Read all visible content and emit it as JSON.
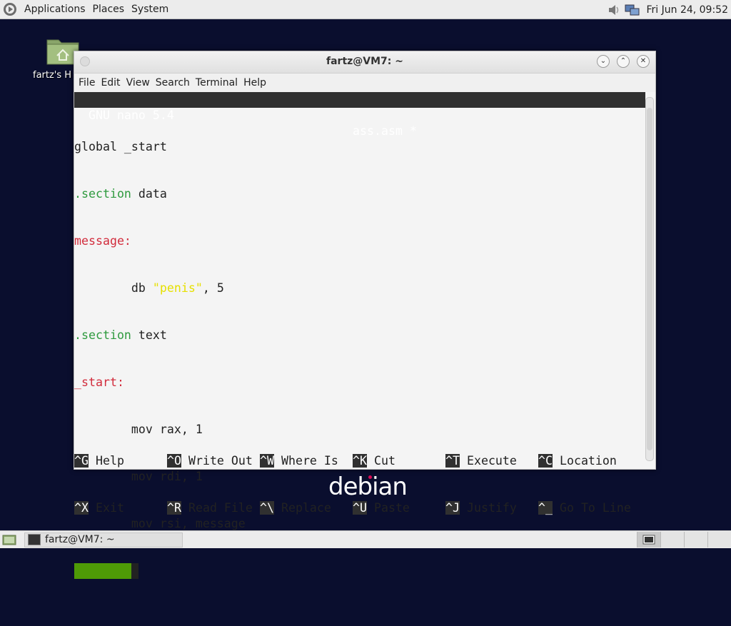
{
  "top_panel": {
    "menus": [
      "Applications",
      "Places",
      "System"
    ],
    "clock": "Fri Jun 24, 09:52"
  },
  "desktop": {
    "home_icon_label": "fartz's H",
    "logo_text": "debian"
  },
  "window": {
    "title": "fartz@VM7: ~",
    "menu": [
      "File",
      "Edit",
      "View",
      "Search",
      "Terminal",
      "Help"
    ]
  },
  "nano": {
    "version": "GNU nano 5.4",
    "filename": "ass.asm *",
    "lines": {
      "l1": "global _start",
      "l2_kw": ".section",
      "l2_rest": " data",
      "l3": "message:",
      "l4_pre": "        db ",
      "l4_str": "\"penis\"",
      "l4_post": ", 5",
      "l5_kw": ".section",
      "l5_rest": " text",
      "l6": "_start:",
      "l7": "        mov rax, 1",
      "l8": "        mov rdi, 1",
      "l9": "        mov rsi, message"
    },
    "shortcuts_row1": [
      {
        "key": "^G",
        "label": " Help"
      },
      {
        "key": "^O",
        "label": " Write Out"
      },
      {
        "key": "^W",
        "label": " Where Is"
      },
      {
        "key": "^K",
        "label": " Cut"
      },
      {
        "key": "^T",
        "label": " Execute"
      },
      {
        "key": "^C",
        "label": " Location"
      }
    ],
    "shortcuts_row2": [
      {
        "key": "^X",
        "label": " Exit"
      },
      {
        "key": "^R",
        "label": " Read File"
      },
      {
        "key": "^\\",
        "label": " Replace"
      },
      {
        "key": "^U",
        "label": " Paste"
      },
      {
        "key": "^J",
        "label": " Justify"
      },
      {
        "key": "^_",
        "label": " Go To Line"
      }
    ]
  },
  "taskbar": {
    "task_label": "fartz@VM7: ~"
  }
}
